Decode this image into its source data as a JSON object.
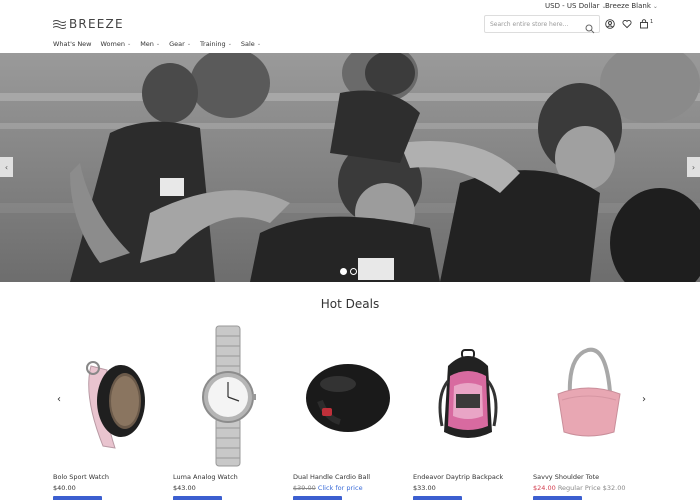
{
  "topbar": {
    "currency": "USD - US Dollar",
    "store": "Breeze Blank"
  },
  "header": {
    "logo_text": "BREEZE",
    "search_placeholder": "Search entire store here...",
    "cart_count": "1"
  },
  "nav": {
    "items": [
      {
        "label": "What's New",
        "has_dropdown": false
      },
      {
        "label": "Women",
        "has_dropdown": true
      },
      {
        "label": "Men",
        "has_dropdown": true
      },
      {
        "label": "Gear",
        "has_dropdown": true
      },
      {
        "label": "Training",
        "has_dropdown": true
      },
      {
        "label": "Sale",
        "has_dropdown": true
      }
    ]
  },
  "hero": {
    "slides": 2,
    "active_slide": 1
  },
  "section": {
    "title": "Hot Deals"
  },
  "products": [
    {
      "name": "Bolo Sport Watch",
      "price": "$40.00"
    },
    {
      "name": "Luma Analog Watch",
      "price": "$43.00"
    },
    {
      "name": "Dual Handle Cardio Ball",
      "old_price": "$39.00",
      "click_label": "Click for price"
    },
    {
      "name": "Endeavor Daytrip Backpack",
      "price": "$33.00"
    },
    {
      "name": "Savvy Shoulder Tote",
      "sale_price": "$24.00",
      "regular_label": "Regular Price",
      "regular_price": "$32.00"
    }
  ],
  "colors": {
    "button": "#3c5fd0",
    "link": "#3a6bd8",
    "sale": "#d23b4d"
  }
}
